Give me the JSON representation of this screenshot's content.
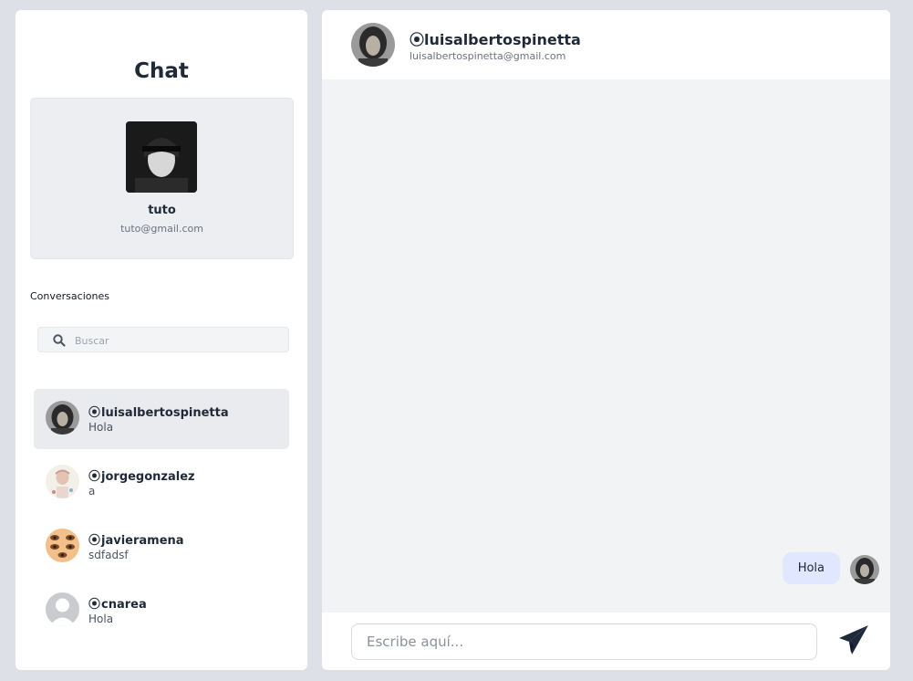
{
  "sidebar": {
    "title": "Chat",
    "profile": {
      "name": "tuto",
      "email": "tuto@gmail.com"
    },
    "section_label": "Conversaciones",
    "search": {
      "placeholder": "Buscar",
      "icon": "search-icon"
    },
    "conversations": [
      {
        "handle": "luisalbertospinetta",
        "last_message": "Hola",
        "active": true
      },
      {
        "handle": "jorgegonzalez",
        "last_message": "a",
        "active": false
      },
      {
        "handle": "javieramena",
        "last_message": "sdfadsf",
        "active": false
      },
      {
        "handle": "cnarea",
        "last_message": "Hola",
        "active": false
      }
    ],
    "handle_prefix_icon": "at-sign-icon"
  },
  "chat": {
    "header": {
      "handle": "luisalbertospinetta",
      "email": "luisalbertospinetta@gmail.com"
    },
    "messages": [
      {
        "text": "Hola",
        "from_me": true
      }
    ],
    "composer": {
      "placeholder": "Escribe aquí...",
      "send_icon": "send-icon"
    }
  },
  "colors": {
    "background": "#dde1e7",
    "bubble": "#e0e7ff",
    "send_icon": "#1e293b",
    "active_item": "#e9ebee"
  }
}
